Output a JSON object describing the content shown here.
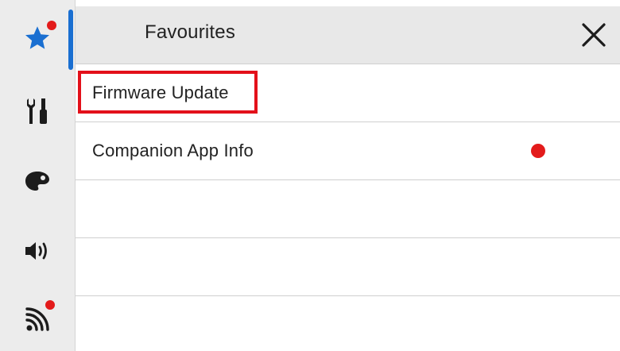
{
  "sidebar": {
    "items": [
      {
        "icon": "star-icon",
        "active": true,
        "has_badge": true
      },
      {
        "icon": "tools-icon",
        "active": false,
        "has_badge": false
      },
      {
        "icon": "palette-icon",
        "active": false,
        "has_badge": false
      },
      {
        "icon": "volume-icon",
        "active": false,
        "has_badge": false
      },
      {
        "icon": "rss-icon",
        "active": false,
        "has_badge": true
      }
    ]
  },
  "panel": {
    "title": "Favourites",
    "close_icon": "close-icon",
    "items": [
      {
        "label": "Firmware Update",
        "highlighted": true,
        "has_dot": false
      },
      {
        "label": "Companion App Info",
        "highlighted": false,
        "has_dot": true
      },
      {
        "label": "",
        "highlighted": false,
        "has_dot": false
      },
      {
        "label": "",
        "highlighted": false,
        "has_dot": false
      },
      {
        "label": "",
        "highlighted": false,
        "has_dot": false
      }
    ]
  },
  "colors": {
    "accent": "#1a6fd1",
    "badge": "#e31b1b",
    "highlight": "#e3101a",
    "rail_bg": "#ececec",
    "header_bg": "#e8e8e8"
  }
}
